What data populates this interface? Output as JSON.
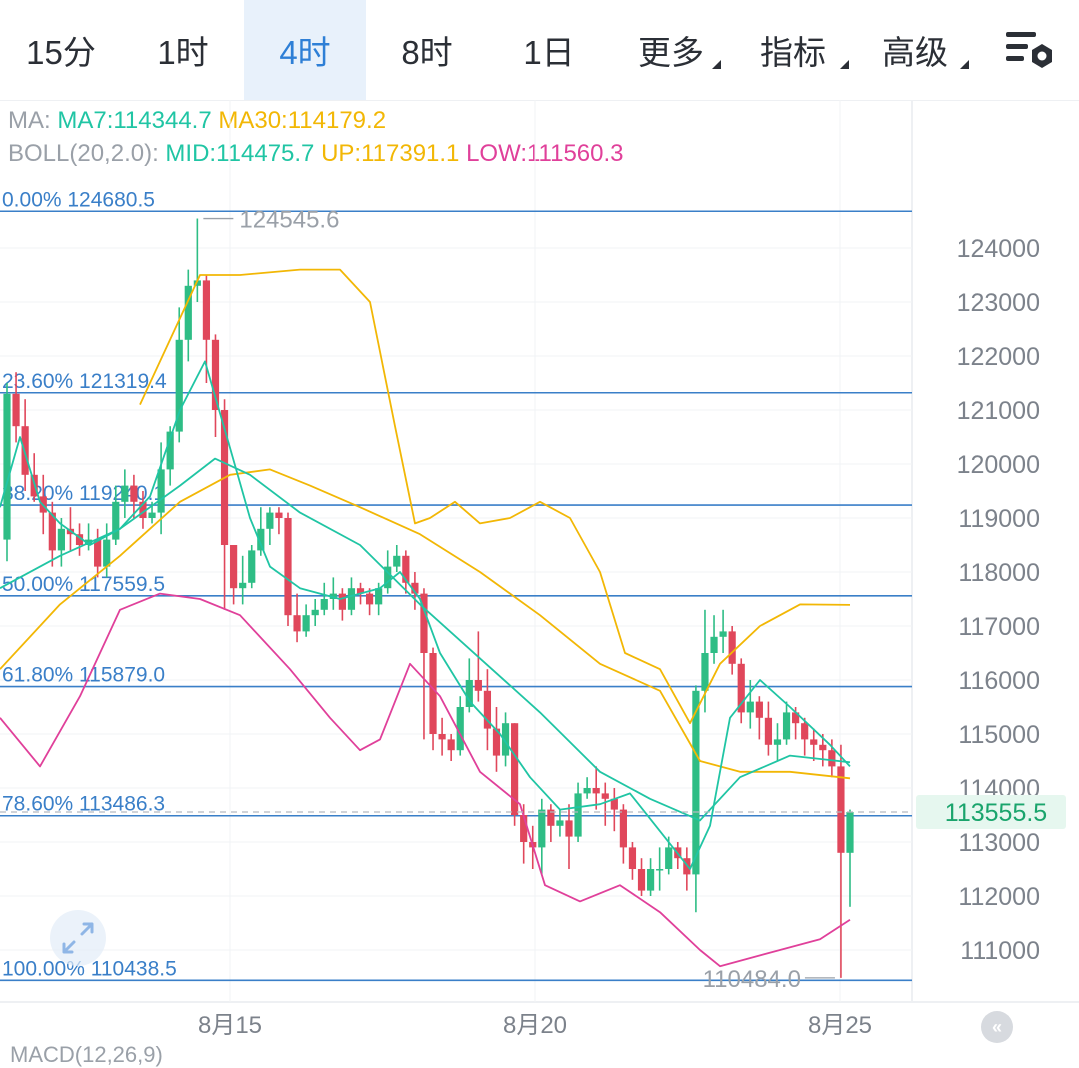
{
  "tabs": [
    {
      "label": "15分",
      "active": false
    },
    {
      "label": "1时",
      "active": false
    },
    {
      "label": "4时",
      "active": true
    },
    {
      "label": "8时",
      "active": false
    },
    {
      "label": "1日",
      "active": false
    },
    {
      "label": "更多",
      "active": false,
      "dropdown": true
    },
    {
      "label": "指标",
      "active": false,
      "dropdown": true
    },
    {
      "label": "高级",
      "active": false,
      "dropdown": true
    }
  ],
  "settings_icon": "chart-settings-icon",
  "indicators": {
    "ma": {
      "label": "MA:",
      "ma7": "MA7:114344.7",
      "ma30": "MA30:114179.2"
    },
    "boll": {
      "label": "BOLL(20,2.0):",
      "mid": "MID:114475.7",
      "up": "UP:117391.1",
      "low": "LOW:111560.3"
    }
  },
  "colors": {
    "up": "#2ebd85",
    "down": "#e0475b",
    "ma7": "#20c5a4",
    "ma30": "#f2b705",
    "boll_low": "#e0409a",
    "fib": "#3a7fc8",
    "price_tag_bg": "#e6f7ef",
    "price_tag_text": "#1aa46c"
  },
  "fib_levels": [
    {
      "label": "0.00% 124680.5",
      "price": 124680.5
    },
    {
      "label": "23.60% 121319.4",
      "price": 121319.4
    },
    {
      "label": "38.20% 119240.1",
      "price": 119240.1
    },
    {
      "label": "50.00% 117559.5",
      "price": 117559.5
    },
    {
      "label": "61.80% 115879.0",
      "price": 115879.0
    },
    {
      "label": "78.60% 113486.3",
      "price": 113486.3
    },
    {
      "label": "100.00% 110438.5",
      "price": 110438.5
    }
  ],
  "y_axis_ticks": [
    "124000",
    "123000",
    "122000",
    "121000",
    "120000",
    "119000",
    "118000",
    "117000",
    "116000",
    "115000",
    "114000",
    "113000",
    "112000",
    "111000"
  ],
  "x_axis_ticks": [
    "8月15",
    "8月20",
    "8月25"
  ],
  "high_marker": "124545.6",
  "low_marker": "110484.0",
  "current_price": "113555.5",
  "chart_data": {
    "type": "candlestick",
    "price_range": [
      110250,
      125100
    ],
    "candles": [
      [
        118600,
        121300,
        118200,
        121500
      ],
      [
        121300,
        120700,
        120400,
        121700
      ],
      [
        120700,
        119800,
        119500,
        121200
      ],
      [
        119800,
        119400,
        119300,
        120200
      ],
      [
        119400,
        119100,
        118700,
        119800
      ],
      [
        119100,
        118400,
        118100,
        119300
      ],
      [
        118400,
        118800,
        118100,
        119000
      ],
      [
        118800,
        118700,
        118400,
        119200
      ],
      [
        118700,
        118500,
        118300,
        118900
      ],
      [
        118500,
        118600,
        118400,
        118900
      ],
      [
        118600,
        118100,
        117900,
        118800
      ],
      [
        118100,
        118600,
        117900,
        118900
      ],
      [
        118600,
        119300,
        118500,
        119600
      ],
      [
        119300,
        119600,
        119000,
        119900
      ],
      [
        119600,
        119300,
        119000,
        119800
      ],
      [
        119300,
        119000,
        118800,
        119500
      ],
      [
        119000,
        119100,
        118900,
        119300
      ],
      [
        119100,
        119900,
        118700,
        120400
      ],
      [
        119900,
        120600,
        119600,
        120700
      ],
      [
        120600,
        122300,
        120400,
        122900
      ],
      [
        122300,
        123300,
        121900,
        123600
      ],
      [
        123300,
        123400,
        123000,
        124545.6
      ],
      [
        123400,
        122300,
        121500,
        123500
      ],
      [
        122300,
        121000,
        120500,
        122400
      ],
      [
        121000,
        118500,
        117300,
        121200
      ],
      [
        118500,
        117700,
        117400,
        118100
      ],
      [
        117700,
        117800,
        117400,
        118300
      ],
      [
        117800,
        118400,
        117700,
        118500
      ],
      [
        118400,
        118800,
        118300,
        119200
      ],
      [
        118800,
        119100,
        118500,
        119200
      ],
      [
        119100,
        119000,
        118700,
        119200
      ],
      [
        119000,
        117200,
        117000,
        119100
      ],
      [
        117200,
        116900,
        116700,
        117600
      ],
      [
        116900,
        117200,
        116800,
        117400
      ],
      [
        117200,
        117300,
        117000,
        117500
      ],
      [
        117300,
        117500,
        117200,
        117800
      ],
      [
        117500,
        117600,
        117300,
        117900
      ],
      [
        117600,
        117300,
        117100,
        117700
      ],
      [
        117300,
        117700,
        117200,
        117900
      ],
      [
        117700,
        117600,
        117400,
        117800
      ],
      [
        117600,
        117400,
        117200,
        117700
      ],
      [
        117400,
        117700,
        117200,
        117800
      ],
      [
        117700,
        118100,
        117600,
        118400
      ],
      [
        118100,
        118300,
        118000,
        118500
      ],
      [
        118300,
        117800,
        117600,
        118400
      ],
      [
        117800,
        117600,
        117300,
        118000
      ],
      [
        117600,
        116500,
        114900,
        117700
      ],
      [
        116500,
        115000,
        114700,
        116600
      ],
      [
        115000,
        114900,
        114600,
        115300
      ],
      [
        114900,
        114700,
        114500,
        115000
      ],
      [
        114700,
        115500,
        114600,
        115700
      ],
      [
        115500,
        116000,
        115400,
        116400
      ],
      [
        116000,
        115800,
        115600,
        116900
      ],
      [
        115800,
        115100,
        114700,
        116200
      ],
      [
        115100,
        114600,
        114300,
        115500
      ],
      [
        114600,
        115200,
        114400,
        115400
      ],
      [
        115200,
        113500,
        113300,
        115200
      ],
      [
        113500,
        113000,
        112600,
        113700
      ],
      [
        113000,
        112900,
        112500,
        113300
      ],
      [
        112900,
        113600,
        112400,
        113800
      ],
      [
        113600,
        113300,
        113000,
        113700
      ],
      [
        113300,
        113400,
        113100,
        113600
      ],
      [
        113400,
        113100,
        112500,
        113700
      ],
      [
        113100,
        113900,
        113000,
        114100
      ],
      [
        113900,
        114000,
        113800,
        114200
      ],
      [
        114000,
        113900,
        113600,
        114400
      ],
      [
        113900,
        113800,
        113300,
        114100
      ],
      [
        113800,
        113600,
        113200,
        114000
      ],
      [
        113600,
        112900,
        112600,
        113700
      ],
      [
        112900,
        112500,
        112300,
        113000
      ],
      [
        112500,
        112100,
        112000,
        112700
      ],
      [
        112100,
        112500,
        112000,
        112700
      ],
      [
        112500,
        112500,
        112100,
        112900
      ],
      [
        112500,
        112900,
        112400,
        113100
      ],
      [
        112900,
        112700,
        112500,
        113000
      ],
      [
        112700,
        112400,
        112100,
        112900
      ],
      [
        112400,
        115800,
        111700,
        115900
      ],
      [
        115800,
        116500,
        115400,
        117300
      ],
      [
        116500,
        116800,
        116300,
        117200
      ],
      [
        116800,
        116900,
        116500,
        117300
      ],
      [
        116900,
        116300,
        116100,
        117000
      ],
      [
        116300,
        115400,
        115200,
        116400
      ],
      [
        115400,
        115600,
        115100,
        116000
      ],
      [
        115600,
        115300,
        114900,
        115700
      ],
      [
        115300,
        114800,
        114600,
        115600
      ],
      [
        114800,
        114900,
        114500,
        115200
      ],
      [
        114900,
        115400,
        114800,
        115600
      ],
      [
        115400,
        115200,
        114900,
        115500
      ],
      [
        115200,
        114900,
        114600,
        115300
      ],
      [
        114900,
        114800,
        114500,
        115100
      ],
      [
        114800,
        114700,
        114400,
        115000
      ],
      [
        114700,
        114400,
        114200,
        114900
      ],
      [
        114400,
        112800,
        110484.0,
        114800
      ],
      [
        112800,
        113555.5,
        111800,
        113600
      ]
    ],
    "ma7": [
      [
        0,
        119200
      ],
      [
        20,
        120500
      ],
      [
        40,
        119300
      ],
      [
        60,
        118900
      ],
      [
        90,
        118500
      ],
      [
        120,
        118800
      ],
      [
        150,
        119400
      ],
      [
        180,
        121000
      ],
      [
        205,
        121900
      ],
      [
        230,
        120300
      ],
      [
        250,
        119000
      ],
      [
        270,
        118100
      ],
      [
        300,
        117700
      ],
      [
        340,
        117500
      ],
      [
        380,
        117700
      ],
      [
        400,
        118000
      ],
      [
        420,
        117500
      ],
      [
        440,
        116500
      ],
      [
        470,
        115600
      ],
      [
        500,
        115000
      ],
      [
        530,
        114200
      ],
      [
        560,
        113600
      ],
      [
        600,
        113700
      ],
      [
        630,
        113900
      ],
      [
        660,
        113200
      ],
      [
        690,
        112500
      ],
      [
        710,
        113300
      ],
      [
        730,
        115300
      ],
      [
        760,
        116000
      ],
      [
        790,
        115500
      ],
      [
        830,
        114800
      ],
      [
        850,
        114400
      ]
    ],
    "ma30": [
      [
        0,
        116200
      ],
      [
        60,
        117400
      ],
      [
        120,
        118300
      ],
      [
        180,
        119300
      ],
      [
        230,
        119800
      ],
      [
        270,
        119900
      ],
      [
        310,
        119600
      ],
      [
        360,
        119200
      ],
      [
        420,
        118700
      ],
      [
        480,
        118000
      ],
      [
        540,
        117200
      ],
      [
        600,
        116300
      ],
      [
        660,
        115800
      ],
      [
        700,
        114500
      ],
      [
        740,
        114300
      ],
      [
        790,
        114300
      ],
      [
        850,
        114179.2
      ]
    ],
    "boll_mid": [
      [
        0,
        117700
      ],
      [
        60,
        118300
      ],
      [
        120,
        118800
      ],
      [
        180,
        119600
      ],
      [
        215,
        120100
      ],
      [
        250,
        119800
      ],
      [
        300,
        119100
      ],
      [
        360,
        118500
      ],
      [
        420,
        117400
      ],
      [
        480,
        116400
      ],
      [
        540,
        115400
      ],
      [
        600,
        114300
      ],
      [
        650,
        113800
      ],
      [
        700,
        113400
      ],
      [
        740,
        114200
      ],
      [
        790,
        114600
      ],
      [
        850,
        114475.7
      ]
    ],
    "boll_up": [
      [
        140,
        121100
      ],
      [
        200,
        123500
      ],
      [
        240,
        123500
      ],
      [
        300,
        123600
      ],
      [
        340,
        123600
      ],
      [
        370,
        123000
      ],
      [
        395,
        120700
      ],
      [
        415,
        118900
      ],
      [
        430,
        119000
      ],
      [
        455,
        119300
      ],
      [
        480,
        118900
      ],
      [
        510,
        119000
      ],
      [
        540,
        119300
      ],
      [
        570,
        119000
      ],
      [
        600,
        118000
      ],
      [
        625,
        116500
      ],
      [
        660,
        116200
      ],
      [
        690,
        115200
      ],
      [
        720,
        116300
      ],
      [
        760,
        117000
      ],
      [
        800,
        117400
      ],
      [
        850,
        117391.1
      ]
    ],
    "boll_low": [
      [
        0,
        115300
      ],
      [
        40,
        114400
      ],
      [
        80,
        115700
      ],
      [
        120,
        117300
      ],
      [
        160,
        117600
      ],
      [
        200,
        117500
      ],
      [
        240,
        117200
      ],
      [
        290,
        116200
      ],
      [
        330,
        115300
      ],
      [
        360,
        114700
      ],
      [
        380,
        114900
      ],
      [
        410,
        116300
      ],
      [
        440,
        115700
      ],
      [
        480,
        114300
      ],
      [
        520,
        113700
      ],
      [
        545,
        112200
      ],
      [
        580,
        111900
      ],
      [
        620,
        112200
      ],
      [
        660,
        111700
      ],
      [
        700,
        111000
      ],
      [
        720,
        110700
      ],
      [
        760,
        110900
      ],
      [
        820,
        111200
      ],
      [
        850,
        111560.3
      ]
    ],
    "x_axis": {
      "ticks": [
        "8月15",
        "8月20",
        "8月25"
      ]
    },
    "y_axis": {
      "range": [
        110250,
        125100
      ]
    }
  },
  "macd_peek": "MACD(12,26,9)"
}
